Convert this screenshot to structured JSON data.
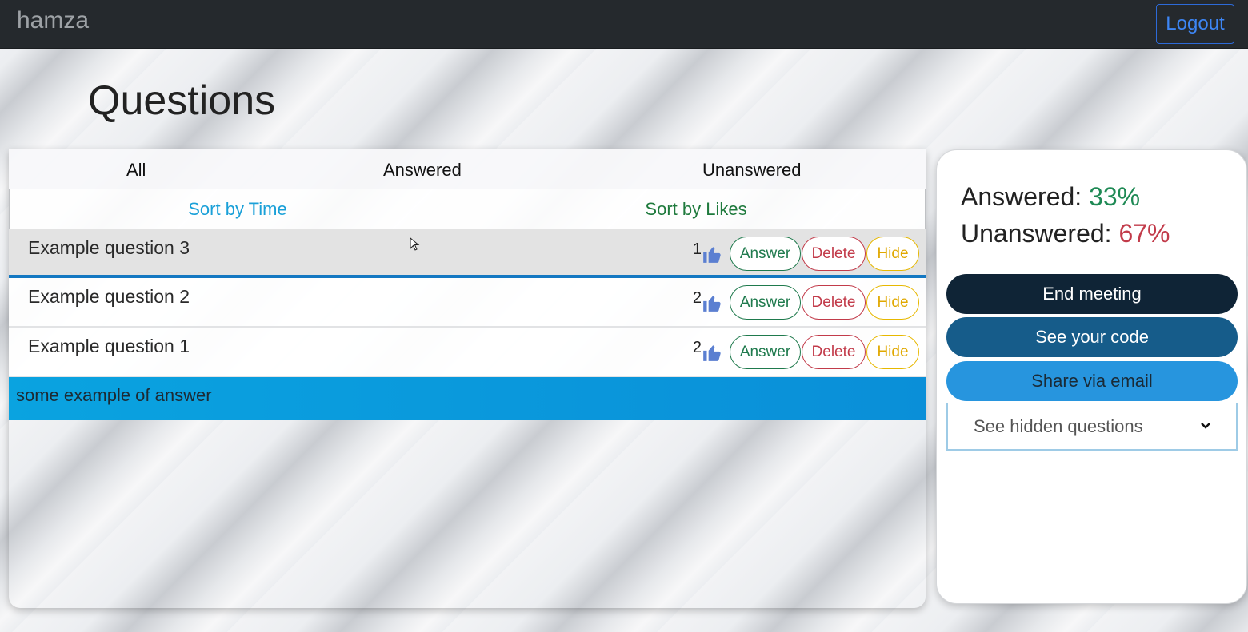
{
  "nav": {
    "brand": "hamza",
    "logout_label": "Logout"
  },
  "page": {
    "title": "Questions"
  },
  "filters": {
    "all": "All",
    "answered": "Answered",
    "unanswered": "Unanswered"
  },
  "sort": {
    "time": "Sort by Time",
    "likes": "Sort by Likes"
  },
  "questions": [
    {
      "text": "Example question 3",
      "likes": "1",
      "answer": "Answer",
      "delete": "Delete",
      "hide": "Hide"
    },
    {
      "text": "Example question 2",
      "likes": "2",
      "answer": "Answer",
      "delete": "Delete",
      "hide": "Hide"
    },
    {
      "text": "Example question 1",
      "likes": "2",
      "answer": "Answer",
      "delete": "Delete",
      "hide": "Hide"
    }
  ],
  "answer_text": "some example of answer",
  "stats": {
    "answered_label": "Answered:",
    "answered_pct": "33%",
    "unanswered_label": "Unanswered:",
    "unanswered_pct": "67%"
  },
  "actions": {
    "end_meeting": "End meeting",
    "see_code": "See your code",
    "share_email": "Share via email",
    "hidden_questions": "See hidden questions"
  },
  "colors": {
    "navbar": "#25292d",
    "answered_green": "#1f8a55",
    "unanswered_red": "#c23b4a",
    "hide_yellow": "#e0a800",
    "answer_blue": "#0aa3e0"
  },
  "icons": [
    "thumbs-up-icon",
    "chevron-down-icon",
    "mouse-cursor-icon"
  ]
}
